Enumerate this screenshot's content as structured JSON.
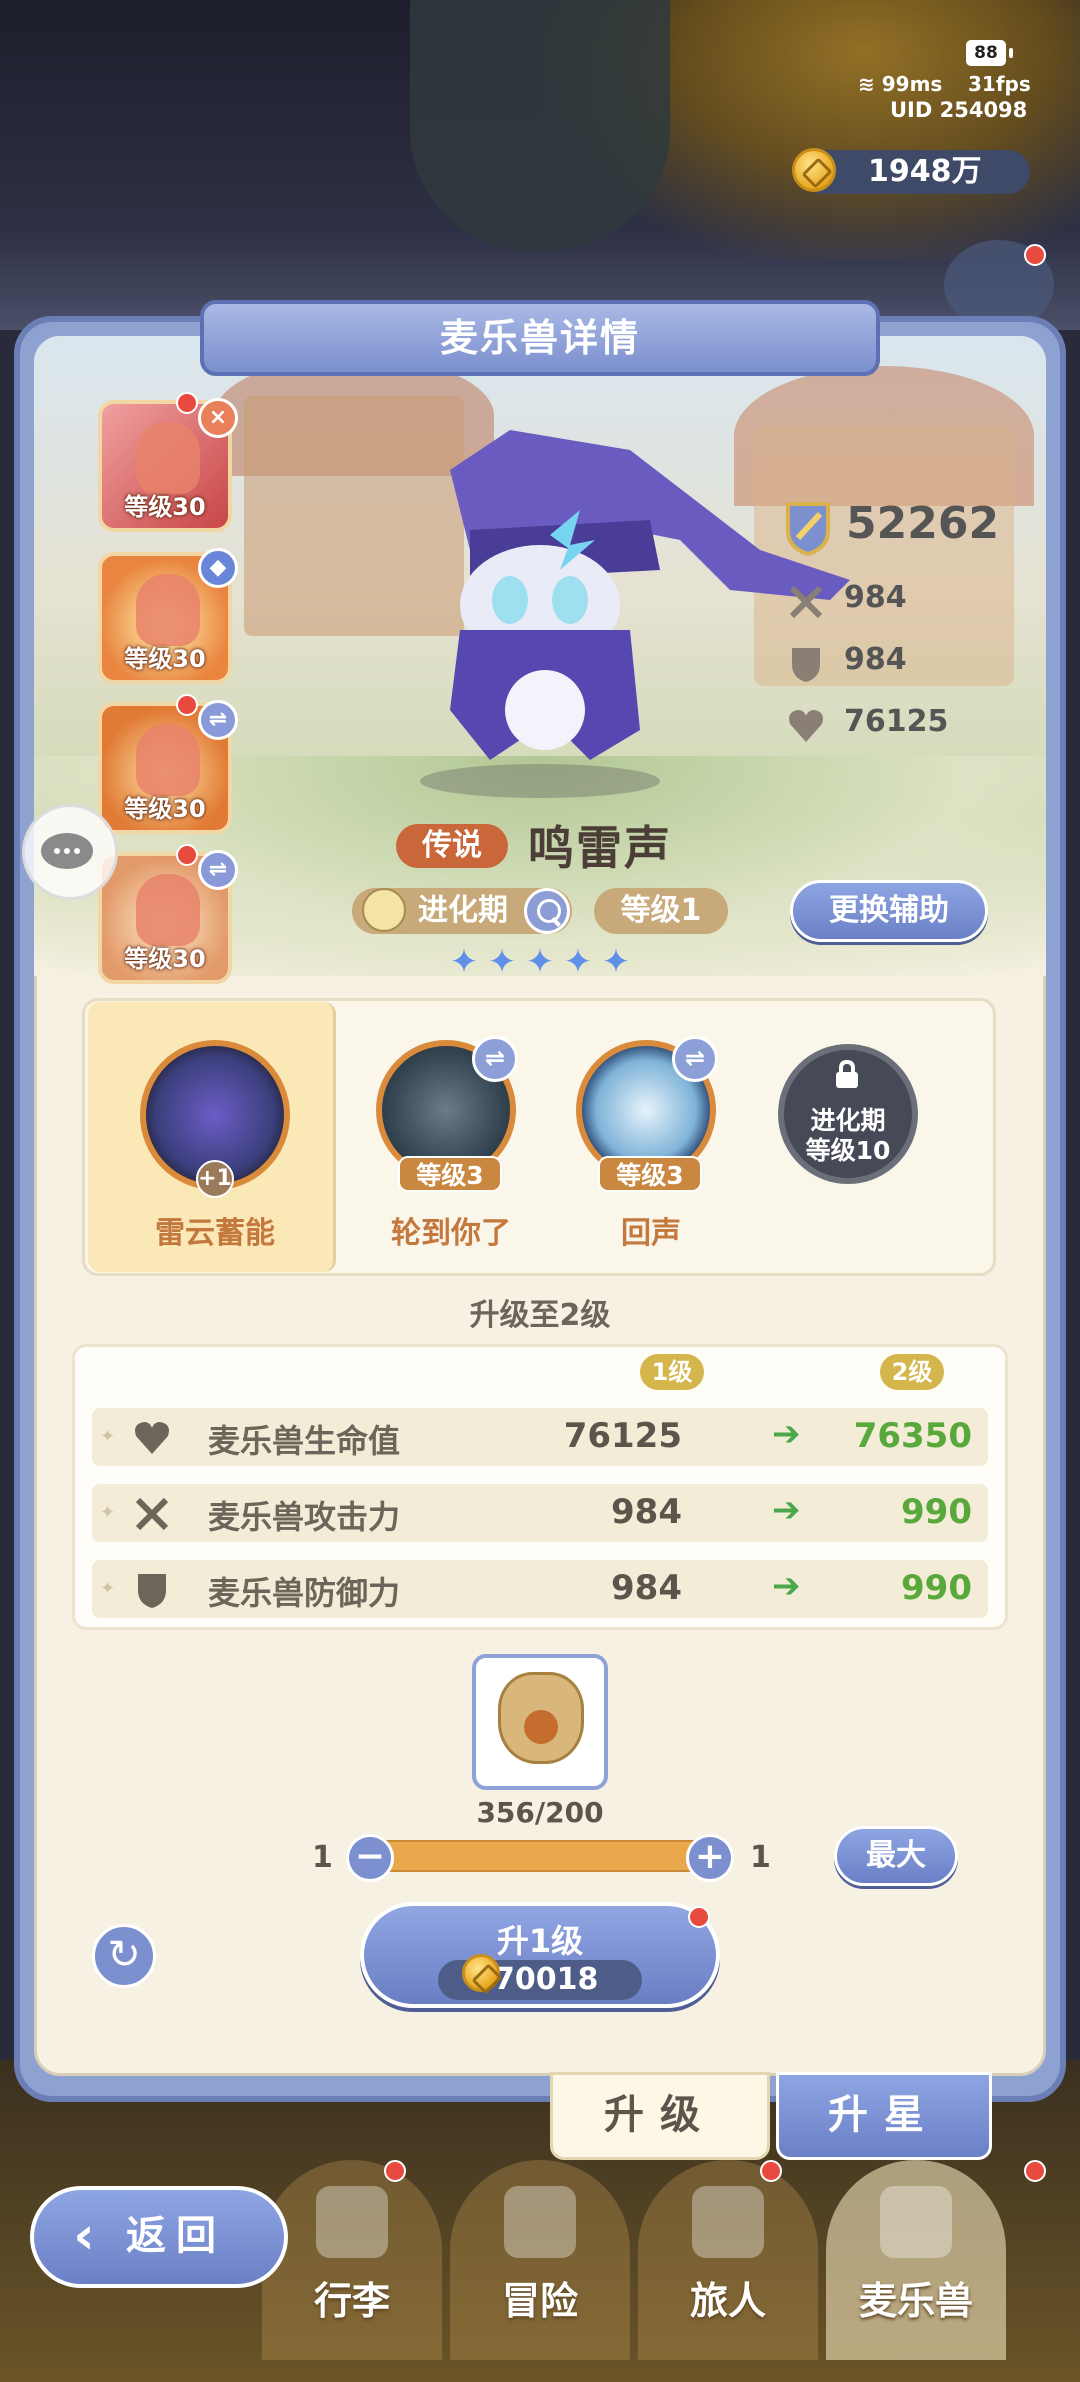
{
  "status": {
    "battery": "88",
    "ping": "99ms",
    "fps": "31fps",
    "uid": "UID  254098"
  },
  "currency": {
    "coins": "1948万"
  },
  "panel": {
    "title": "麦乐兽详情"
  },
  "allies": [
    {
      "level": "等级30",
      "badge": "x-icon",
      "bg": "#e96a6a"
    },
    {
      "level": "等级30",
      "badge": "shield-icon",
      "bg": "#e68a4d"
    },
    {
      "level": "等级30",
      "badge": "swap-icon",
      "bg": "#e7874a"
    },
    {
      "level": "等级30",
      "badge": "swap-icon",
      "bg": "#e59a66"
    }
  ],
  "monster": {
    "power": "52262",
    "attack": "984",
    "defense": "984",
    "hp": "76125",
    "rarity": "传说",
    "name": "鸣雷声",
    "stage": "进化期",
    "level": "等级1",
    "stars": 5
  },
  "assist_button": "更换辅助",
  "skills": [
    {
      "name": "雷云蓄能",
      "tag": "+1",
      "selected": true
    },
    {
      "name": "轮到你了",
      "level": "等级3"
    },
    {
      "name": "回声",
      "level": "等级3"
    },
    {
      "locked_line1": "进化期",
      "locked_line2": "等级10"
    }
  ],
  "upgrade": {
    "title": "升级至2级",
    "col_current": "1级",
    "col_next": "2级",
    "rows": [
      {
        "label": "麦乐兽生命值",
        "current": "76125",
        "next": "76350",
        "icon": "heart-icon"
      },
      {
        "label": "麦乐兽攻击力",
        "current": "984",
        "next": "990",
        "icon": "swords-icon"
      },
      {
        "label": "麦乐兽防御力",
        "current": "984",
        "next": "990",
        "icon": "shield-icon"
      }
    ],
    "arrow": "➔"
  },
  "item": {
    "count": "356/200"
  },
  "slider": {
    "min": "1",
    "max": "1",
    "minus": "−",
    "plus": "+"
  },
  "max_button": "最大",
  "level_up_button": {
    "label": "升1级",
    "cost": "70018"
  },
  "tabs": {
    "upgrade": "升级",
    "star": "升星"
  },
  "back_button": "返回",
  "nav": [
    "行李",
    "冒险",
    "旅人",
    "麦乐兽"
  ],
  "colors": {
    "accent": "#7c90d0",
    "panel": "#f7f1e3",
    "green": "#58a83c"
  }
}
